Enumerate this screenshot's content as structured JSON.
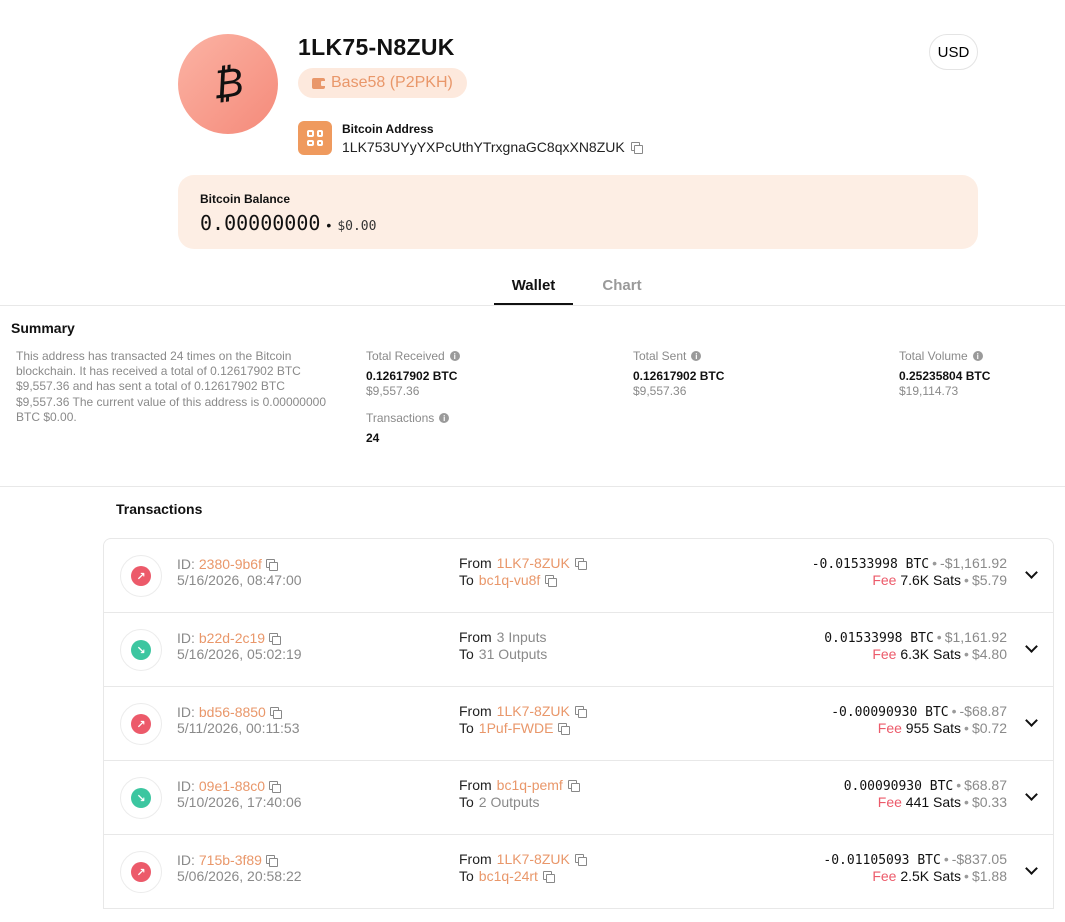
{
  "address": {
    "short": "1LK75-N8ZUK",
    "type_badge": "Base58 (P2PKH)",
    "label": "Bitcoin Address",
    "full": "1LK753UYyYXPcUthYTrxgnaGC8qxXN8ZUK",
    "coin_symbol": "₿"
  },
  "currency": {
    "label": "USD"
  },
  "balance": {
    "label": "Bitcoin Balance",
    "btc": "0.00000000",
    "separator": "•",
    "usd": "$0.00"
  },
  "tabs": [
    {
      "label": "Wallet",
      "active": true
    },
    {
      "label": "Chart",
      "active": false
    }
  ],
  "summary": {
    "title": "Summary",
    "text": "This address has transacted 24 times on the Bitcoin blockchain. It has received a total of 0.12617902 BTC $9,557.36 and has sent a total of 0.12617902 BTC $9,557.36 The current value of this address is 0.00000000 BTC $0.00.",
    "stats": {
      "received": {
        "label": "Total Received",
        "btc": "0.12617902 BTC",
        "usd": "$9,557.36"
      },
      "sent": {
        "label": "Total Sent",
        "btc": "0.12617902 BTC",
        "usd": "$9,557.36"
      },
      "volume": {
        "label": "Total Volume",
        "btc": "0.25235804 BTC",
        "usd": "$19,114.73"
      },
      "transactions": {
        "label": "Transactions",
        "value": "24"
      }
    }
  },
  "transactions_section": {
    "title": "Transactions",
    "id_prefix": "ID:",
    "from_label": "From",
    "to_label": "To",
    "fee_label": "Fee",
    "bullet": "•",
    "items": [
      {
        "direction": "out",
        "id": "2380-9b6f",
        "time": "5/16/2026, 08:47:00",
        "from": "1LK7-8ZUK",
        "from_is_link": true,
        "to": "bc1q-vu8f",
        "to_is_link": true,
        "amount_btc": "-0.01533998 BTC",
        "amount_usd": "-$1,161.92",
        "fee_sats": "7.6K Sats",
        "fee_usd": "$5.79"
      },
      {
        "direction": "in",
        "id": "b22d-2c19",
        "time": "5/16/2026, 05:02:19",
        "from": "3 Inputs",
        "from_is_link": false,
        "to": "31 Outputs",
        "to_is_link": false,
        "amount_btc": "0.01533998 BTC",
        "amount_usd": "$1,161.92",
        "fee_sats": "6.3K Sats",
        "fee_usd": "$4.80"
      },
      {
        "direction": "out",
        "id": "bd56-8850",
        "time": "5/11/2026, 00:11:53",
        "from": "1LK7-8ZUK",
        "from_is_link": true,
        "to": "1Puf-FWDE",
        "to_is_link": true,
        "amount_btc": "-0.00090930 BTC",
        "amount_usd": "-$68.87",
        "fee_sats": "955 Sats",
        "fee_usd": "$0.72"
      },
      {
        "direction": "in",
        "id": "09e1-88c0",
        "time": "5/10/2026, 17:40:06",
        "from": "bc1q-pemf",
        "from_is_link": true,
        "to": "2 Outputs",
        "to_is_link": false,
        "amount_btc": "0.00090930 BTC",
        "amount_usd": "$68.87",
        "fee_sats": "441 Sats",
        "fee_usd": "$0.33"
      },
      {
        "direction": "out",
        "id": "715b-3f89",
        "time": "5/06/2026, 20:58:22",
        "from": "1LK7-8ZUK",
        "from_is_link": true,
        "to": "bc1q-24rt",
        "to_is_link": true,
        "amount_btc": "-0.01105093 BTC",
        "amount_usd": "-$837.05",
        "fee_sats": "2.5K Sats",
        "fee_usd": "$1.88"
      }
    ]
  },
  "icons": {
    "coin": "bitcoin-icon",
    "badge": "wallet-icon",
    "address": "qr-code-icon",
    "copy": "copy-icon",
    "info": "info-icon",
    "sent": "arrow-up-right-icon",
    "received": "arrow-down-right-icon",
    "expand": "chevron-down-icon"
  },
  "colors": {
    "accent": "#e9976a",
    "badge_bg": "#fde9dd",
    "balance_bg": "#fdeee4",
    "sent": "#ec5a6a",
    "received": "#3cc6a0"
  }
}
